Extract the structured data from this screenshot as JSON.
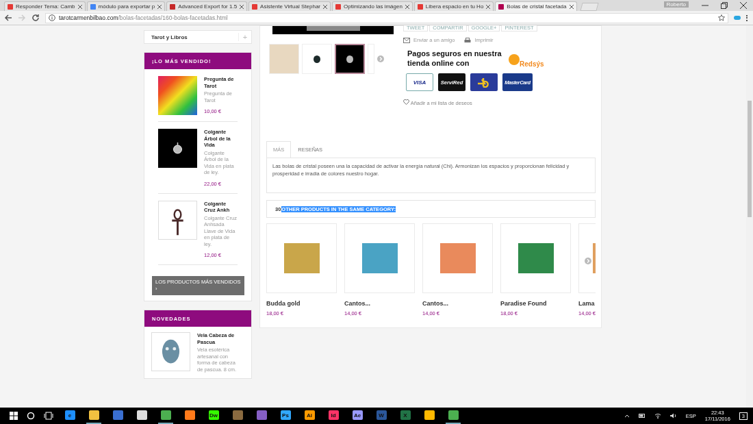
{
  "browser": {
    "tabs": [
      {
        "title": "Responder Tema: Camb",
        "selected": false
      },
      {
        "title": "módulo para exportar p",
        "selected": false
      },
      {
        "title": "Advanced Export for 1.5",
        "selected": false
      },
      {
        "title": "Asistente Virtual Stephar",
        "selected": false
      },
      {
        "title": "Optimizando las imágen",
        "selected": false
      },
      {
        "title": "Libera espacio en tu Ho",
        "selected": false
      },
      {
        "title": "Bolas de cristal facetada",
        "selected": true
      }
    ],
    "profile": "Roberto",
    "url": {
      "domain": "tarotcarmenbilbao.com",
      "path": "/bolas-facetadas/160-bolas-facetadas.html"
    }
  },
  "sidebar": {
    "categories": [
      {
        "label": "Tarot y Libros",
        "expand": "+"
      }
    ],
    "bestsellers": {
      "title": "¡LO MÁS VENDIDO!",
      "items": [
        {
          "name": "Pregunta de Tarot",
          "description": "Pregunta de Tarot",
          "price": "10,00 €"
        },
        {
          "name": "Colgante Árbol de la Vida",
          "description": "Colgante Árbol de la Vida en plata de ley.",
          "price": "22,00 €"
        },
        {
          "name": "Colgante Cruz Ankh",
          "description": "Colgante Cruz Anhsada Llave de Vida en plata de ley.",
          "price": "12,00 €"
        }
      ],
      "button": "LOS PRODUCTOS MÁS VENDIDOS",
      "button_icon": "›"
    },
    "novedades": {
      "title": "NOVEDADES",
      "items": [
        {
          "name": "Vela Cabeza de Pascua",
          "description": "Vela esotérica artesanal con forma de cabeza de pascua. 8 cm."
        }
      ]
    }
  },
  "product": {
    "thumbnails": [
      {
        "selected": false
      },
      {
        "selected": false
      },
      {
        "selected": true
      },
      {
        "selected": false
      }
    ],
    "social": [
      "TWEET",
      "COMPARTIR",
      "GOOGLE+",
      "PINTEREST"
    ],
    "actions": [
      {
        "kind": "mail",
        "label": "Enviar a un amigo"
      },
      {
        "kind": "print",
        "label": "Imprimir"
      }
    ],
    "payment": {
      "text": "Pagos seguros en nuestra tienda online con",
      "brand": "Redsýs",
      "cards": [
        {
          "kind": "visa",
          "label": "VISA"
        },
        {
          "kind": "servired",
          "label": "ServiRed"
        },
        {
          "kind": "fourb"
        },
        {
          "kind": "mastercard",
          "label": "MasterCard"
        }
      ]
    },
    "wishlist": "Añadir a mi lista de deseos",
    "tabs": [
      {
        "label": "MÁS",
        "selected": true
      },
      {
        "label": "RESEÑAS",
        "selected": false
      }
    ],
    "description": "Las  bolas de cristal poseen una la capacidad de activar la energía natural (Chi). Armonizan los espacios y proporcionan felicidad y prosperidad e irradia de colores nuestro hogar."
  },
  "related": {
    "count": "30",
    "title": "OTHER PRODUCTS IN THE SAME CATEGORY:",
    "highlighted": true,
    "products": [
      {
        "name": "Budda gold",
        "price": "18,00 €"
      },
      {
        "name": "Cantos...",
        "price": "14,00 €"
      },
      {
        "name": "Cantos...",
        "price": "14,00 €"
      },
      {
        "name": "Paradise Found",
        "price": "18,00 €"
      },
      {
        "name": "Lama",
        "price": "14,00 €"
      }
    ]
  },
  "taskbar": {
    "apps": [
      {
        "label": "e",
        "active": false
      },
      {
        "active": true
      },
      {
        "active": false
      },
      {
        "active": false
      },
      {
        "active": true
      },
      {
        "active": false
      },
      {
        "label": "Dw",
        "active": false
      },
      {
        "active": false
      },
      {
        "active": false
      },
      {
        "label": "Ps",
        "active": false
      },
      {
        "label": "Ai",
        "active": false
      },
      {
        "label": "Id",
        "active": false
      },
      {
        "label": "Ae",
        "active": false
      },
      {
        "label": "W",
        "active": false
      },
      {
        "label": "X",
        "active": false
      },
      {
        "active": false
      },
      {
        "active": true
      }
    ],
    "language": "ESP",
    "time": "22:43",
    "date": "17/11/2016",
    "notifications": "3"
  }
}
